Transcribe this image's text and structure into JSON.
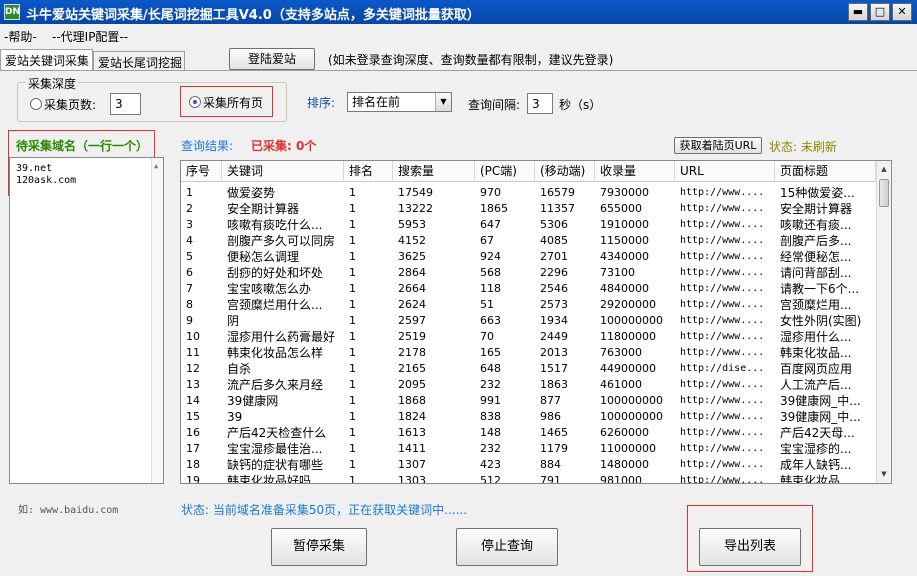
{
  "window": {
    "title": "斗牛爱站关键词采集/长尾词挖掘工具V4.0（支持多站点，多关键词批量获取）",
    "icon_text": "DN",
    "minimize": "▬",
    "maximize": "□",
    "close": "✕"
  },
  "menu": {
    "help": "-帮助-",
    "proxy": "--代理IP配置--"
  },
  "tabs": {
    "collect": "爱站关键词采集",
    "longtail": "爱站长尾词挖掘"
  },
  "login": {
    "button": "登陆爱站",
    "hint": "(如未登录查询深度、查询数量都有限制，建议先登录)"
  },
  "depth": {
    "legend": "采集深度",
    "pages_label": "采集页数:",
    "pages_value": "3",
    "all_label": "采集所有页"
  },
  "sort": {
    "label": "排序:",
    "value": "排名在前"
  },
  "interval": {
    "label": "查询间隔:",
    "value": "3",
    "unit": "秒（s）"
  },
  "domains": {
    "title": "待采集域名（一行一个）",
    "lines": [
      "39.net",
      "120ask.com"
    ],
    "example": "如: www.baidu.com"
  },
  "result": {
    "label": "查询结果:",
    "collected": "已采集: 0个",
    "fetch_button": "获取着陆页URL",
    "status": "状态: 未刷新"
  },
  "table": {
    "columns": [
      "序号",
      "关键词",
      "排名",
      "搜索量",
      "(PC端)",
      "(移动端)",
      "收录量",
      "URL",
      "页面标题"
    ],
    "rows": [
      [
        "1",
        "做爱姿势",
        "1",
        "17549",
        "970",
        "16579",
        "7930000",
        "http://www....",
        "15种做爱姿..."
      ],
      [
        "2",
        "安全期计算器",
        "1",
        "13222",
        "1865",
        "11357",
        "655000",
        "http://www....",
        "安全期计算器"
      ],
      [
        "3",
        "咳嗽有痰吃什么...",
        "1",
        "5953",
        "647",
        "5306",
        "1910000",
        "http://www....",
        "咳嗽还有痰..."
      ],
      [
        "4",
        "剖腹产多久可以同房",
        "1",
        "4152",
        "67",
        "4085",
        "1150000",
        "http://www....",
        "剖腹产后多..."
      ],
      [
        "5",
        "便秘怎么调理",
        "1",
        "3625",
        "924",
        "2701",
        "4340000",
        "http://www....",
        "经常便秘怎..."
      ],
      [
        "6",
        "刮痧的好处和坏处",
        "1",
        "2864",
        "568",
        "2296",
        "73100",
        "http://www....",
        "请问背部刮..."
      ],
      [
        "7",
        "宝宝咳嗽怎么办",
        "1",
        "2664",
        "118",
        "2546",
        "4840000",
        "http://www....",
        "请教一下6个..."
      ],
      [
        "8",
        "宫颈糜烂用什么...",
        "1",
        "2624",
        "51",
        "2573",
        "29200000",
        "http://www....",
        "宫颈糜烂用..."
      ],
      [
        "9",
        "阴",
        "1",
        "2597",
        "663",
        "1934",
        "100000000",
        "http://www....",
        "女性外阴(实图)"
      ],
      [
        "10",
        "湿疹用什么药膏最好",
        "1",
        "2519",
        "70",
        "2449",
        "11800000",
        "http://www....",
        "湿疹用什么..."
      ],
      [
        "11",
        "韩束化妆品怎么样",
        "1",
        "2178",
        "165",
        "2013",
        "763000",
        "http://www....",
        "韩束化妆品..."
      ],
      [
        "12",
        "自杀",
        "1",
        "2165",
        "648",
        "1517",
        "44900000",
        "http://dise...",
        "百度网页应用"
      ],
      [
        "13",
        "流产后多久来月经",
        "1",
        "2095",
        "232",
        "1863",
        "461000",
        "http://www....",
        "人工流产后..."
      ],
      [
        "14",
        "39健康网",
        "1",
        "1868",
        "991",
        "877",
        "100000000",
        "http://www....",
        "39健康网_中..."
      ],
      [
        "15",
        "39",
        "1",
        "1824",
        "838",
        "986",
        "100000000",
        "http://www....",
        "39健康网_中..."
      ],
      [
        "16",
        "产后42天检查什么",
        "1",
        "1613",
        "148",
        "1465",
        "6260000",
        "http://www....",
        "产后42天母..."
      ],
      [
        "17",
        "宝宝湿疹最佳治...",
        "1",
        "1411",
        "232",
        "1179",
        "11000000",
        "http://www....",
        "宝宝湿疹的..."
      ],
      [
        "18",
        "缺钙的症状有哪些",
        "1",
        "1307",
        "423",
        "884",
        "1480000",
        "http://www....",
        "成年人缺钙..."
      ],
      [
        "19",
        "韩束化妆品好吗",
        "1",
        "1303",
        "512",
        "791",
        "981000",
        "http://www....",
        "韩束化妆品..."
      ]
    ]
  },
  "status_bar": "状态: 当前域名准备采集50页，正在获取关键词中......",
  "actions": {
    "pause": "暂停采集",
    "stop": "停止查询",
    "export": "导出列表"
  },
  "colors": {
    "accent_blue": "#1a5fd8",
    "red": "#e03030",
    "green": "#2a8a00",
    "olive": "#8a8a00"
  }
}
